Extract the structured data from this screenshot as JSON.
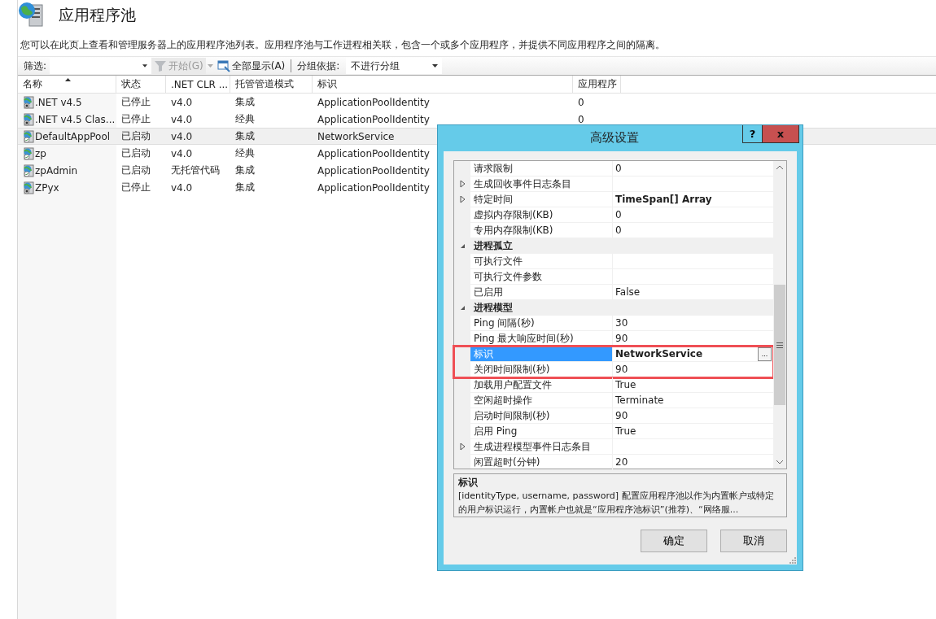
{
  "page": {
    "title": "应用程序池",
    "description": "您可以在此页上查看和管理服务器上的应用程序池列表。应用程序池与工作进程相关联，包含一个或多个应用程序，并提供不同应用程序之间的隔离。"
  },
  "toolbar": {
    "filter_label": "筛选:",
    "start": {
      "label": "开始(G)",
      "disabled": true
    },
    "show_all": {
      "label": "全部显示(A)",
      "disabled": false
    },
    "group_label": "分组依据:",
    "group_value": "不进行分组"
  },
  "table": {
    "columns": [
      {
        "label": "名称",
        "sorted": true
      },
      {
        "label": "状态",
        "sorted": false
      },
      {
        "label": ".NET CLR ...",
        "sorted": false
      },
      {
        "label": "托管管道模式",
        "sorted": false
      },
      {
        "label": "标识",
        "sorted": false
      },
      {
        "label": "应用程序",
        "sorted": false
      }
    ],
    "rows": [
      {
        "cells": [
          ".NET v4.5",
          "已停止",
          "v4.0",
          "集成",
          "ApplicationPoolIdentity",
          "0"
        ],
        "running": false,
        "selected": false
      },
      {
        "cells": [
          ".NET v4.5 Clas...",
          "已停止",
          "v4.0",
          "经典",
          "ApplicationPoolIdentity",
          "0"
        ],
        "running": false,
        "selected": false
      },
      {
        "cells": [
          "DefaultAppPool",
          "已启动",
          "v4.0",
          "集成",
          "NetworkService"
        ],
        "running": true,
        "selected": true
      },
      {
        "cells": [
          "zp",
          "已启动",
          "v4.0",
          "经典",
          "ApplicationPoolIdentity"
        ],
        "running": true,
        "selected": false
      },
      {
        "cells": [
          "zpAdmin",
          "已启动",
          "无托管代码",
          "集成",
          "ApplicationPoolIdentity"
        ],
        "running": true,
        "selected": false
      },
      {
        "cells": [
          "ZPyx",
          "已停止",
          "v4.0",
          "集成",
          "ApplicationPoolIdentity"
        ],
        "running": false,
        "selected": false
      }
    ]
  },
  "dialog": {
    "title": "高级设置",
    "help": "?",
    "close": "x",
    "properties": [
      {
        "kind": "property",
        "name": "请求限制",
        "value": "0"
      },
      {
        "kind": "property",
        "name": "生成回收事件日志条目",
        "expanded": false
      },
      {
        "kind": "property",
        "name": "特定时间",
        "value": "TimeSpan[] Array",
        "modified": true,
        "expanded": false
      },
      {
        "kind": "property",
        "name": "虚拟内存限制(KB)",
        "value": "0"
      },
      {
        "kind": "property",
        "name": "专用内存限制(KB)",
        "value": "0"
      },
      {
        "kind": "category",
        "name": "进程孤立",
        "expanded": true
      },
      {
        "kind": "property",
        "name": "可执行文件"
      },
      {
        "kind": "property",
        "name": "可执行文件参数"
      },
      {
        "kind": "property",
        "name": "已启用",
        "value": "False"
      },
      {
        "kind": "category",
        "name": "进程模型",
        "expanded": true
      },
      {
        "kind": "property",
        "name": "Ping 间隔(秒)",
        "value": "30"
      },
      {
        "kind": "property",
        "name": "Ping 最大响应时间(秒)",
        "value": "90"
      },
      {
        "kind": "property",
        "name": "标识",
        "value": "NetworkService",
        "modified": true,
        "selected": true,
        "button": "...",
        "highlighted": true
      },
      {
        "kind": "property",
        "name": "关闭时间限制(秒)",
        "value": "90",
        "highlighted": true
      },
      {
        "kind": "property",
        "name": "加载用户配置文件",
        "value": "True"
      },
      {
        "kind": "property",
        "name": "空闲超时操作",
        "value": "Terminate"
      },
      {
        "kind": "property",
        "name": "启动时间限制(秒)",
        "value": "90"
      },
      {
        "kind": "property",
        "name": "启用 Ping",
        "value": "True"
      },
      {
        "kind": "property",
        "name": "生成进程模型事件日志条目",
        "expanded": false
      },
      {
        "kind": "property",
        "name": "闲置超时(分钟)",
        "value": "20"
      }
    ],
    "help_title": "标识",
    "help_text": "[identityType, username, password] 配置应用程序池以作为内置帐户或特定的用户标识运行，内置帐户也就是“应用程序池标识”(推荐)、“网络服...",
    "buttons": [
      "确定",
      "取消"
    ]
  }
}
